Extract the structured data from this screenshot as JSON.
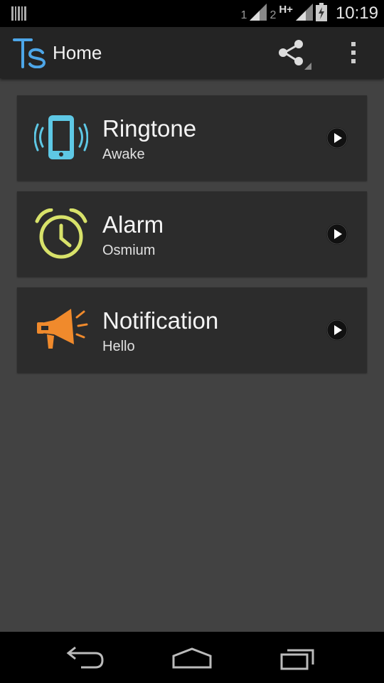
{
  "status_bar": {
    "sim1_label": "1",
    "sim2_label": "2",
    "network_type": "H+",
    "time": "10:19"
  },
  "action_bar": {
    "title": "Home",
    "logo_icon": "ts-logo-icon",
    "share_icon": "share-icon",
    "overflow_icon": "overflow-menu-icon"
  },
  "cards": [
    {
      "title": "Ringtone",
      "subtitle": "Awake",
      "icon": "vibrating-phone-icon",
      "icon_color": "#5ec8e5"
    },
    {
      "title": "Alarm",
      "subtitle": "Osmium",
      "icon": "alarm-clock-icon",
      "icon_color": "#d8e26a"
    },
    {
      "title": "Notification",
      "subtitle": "Hello",
      "icon": "megaphone-icon",
      "icon_color": "#f08a2c"
    }
  ],
  "nav_bar": {
    "back_icon": "back-icon",
    "home_icon": "home-icon",
    "recents_icon": "recents-icon"
  }
}
